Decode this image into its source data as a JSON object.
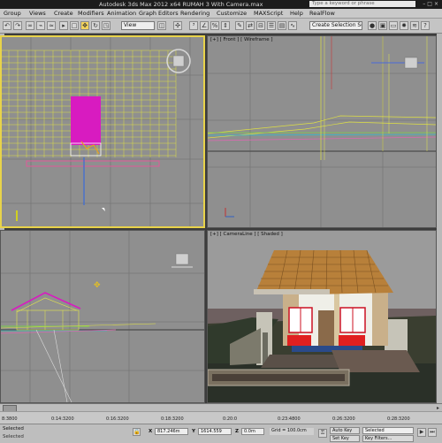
{
  "window": {
    "title": "Autodesk 3ds Max 2012 x64    RUMAH 3 With Camera.max",
    "search_placeholder": "Type a keyword or phrase"
  },
  "menu": [
    "Group",
    "Views",
    "Create",
    "Modifiers",
    "Animation",
    "Graph Editors",
    "Rendering",
    "Customize",
    "MAXScript",
    "Help",
    "RealFlow"
  ],
  "toolbar": {
    "view_dropdown": "View",
    "selection_set": "Create Selection Se"
  },
  "viewports": {
    "top_right_label": "[+] [ Front ] [ Wireframe ]",
    "bottom_right_label": "[+] [ CameraLine ] [ Shaded ]"
  },
  "timeline": {
    "ticks": [
      "8:3800",
      "0:14:3200",
      "0:16:3200",
      "0:18:3200",
      "0:20:0",
      "0:23:4800",
      "0:26:3200",
      "0:28:3200"
    ]
  },
  "status": {
    "selected_label": "Selected",
    "x_value": "817.246m",
    "y_value": "1614.559",
    "z_value": "0.0m",
    "grid": "Grid = 100.0cm",
    "auto_key": "Auto Key",
    "key_mode": "Selected",
    "set_key": "Set Key",
    "key_filters": "Key Filters...",
    "status_text": "Selected"
  },
  "colors": {
    "active_viewport_border": "#e8d34a",
    "wire_yellow": "#e6e84a",
    "magenta": "#d81bc0",
    "roof": "#b8803a",
    "door_red": "#e02020"
  }
}
